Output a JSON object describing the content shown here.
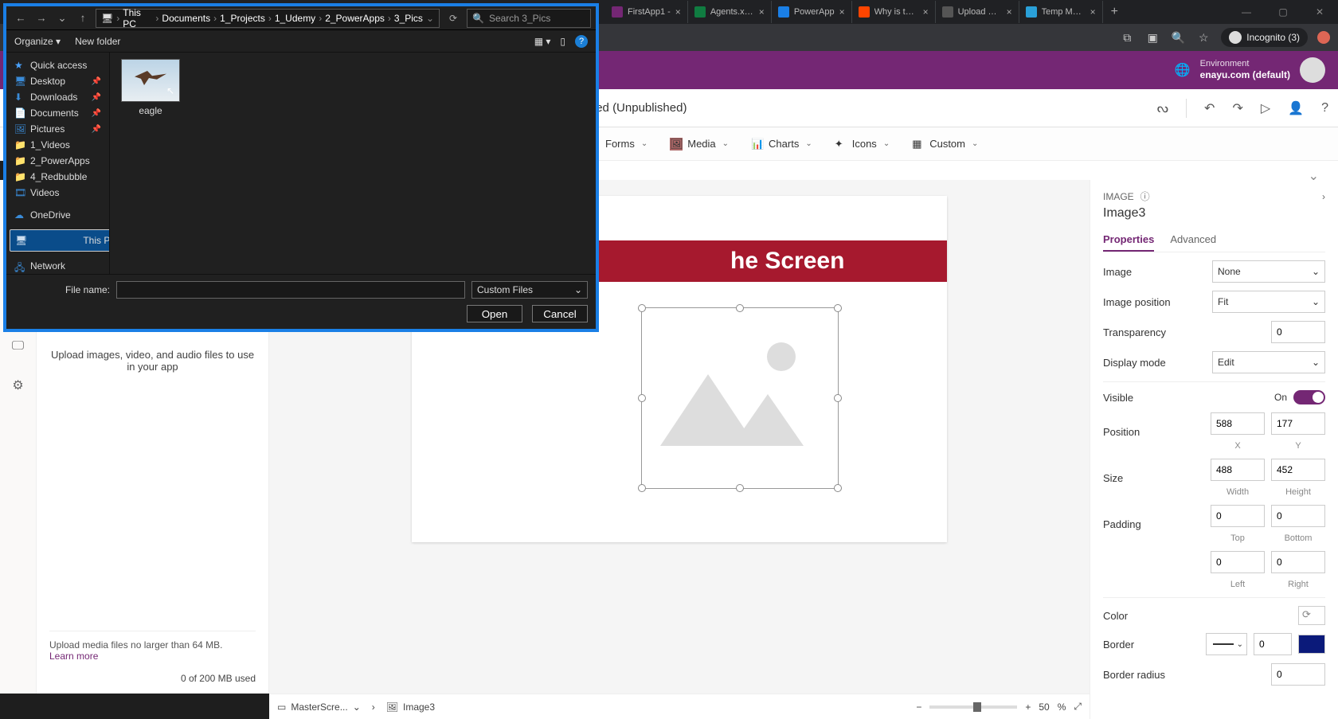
{
  "browser": {
    "tabs": [
      {
        "title": "FirstApp1 -",
        "fav": "#742774"
      },
      {
        "title": "Agents.xlsx",
        "fav": "#107c41"
      },
      {
        "title": "PowerApp",
        "fav": "#1a7fe6"
      },
      {
        "title": "Why is ther",
        "fav": "#ff4500"
      },
      {
        "title": "Upload File",
        "fav": "#444"
      },
      {
        "title": "Temp Mail -",
        "fav": "#2aa0d8"
      }
    ],
    "incognito": "Incognito (3)"
  },
  "env": {
    "label": "Environment",
    "name": "enayu.com (default)"
  },
  "app_title": "FirstCanvasApp - Saved (Unpublished)",
  "ribbon": {
    "forms": "Forms",
    "media": "Media",
    "charts": "Charts",
    "icons": "Icons",
    "custom": "Custom"
  },
  "media_pane": {
    "hint": "Upload images, video, and audio files to use in your app",
    "foot": "Upload media files no larger than 64 MB.",
    "learn": "Learn more",
    "usage": "0 of 200 MB used"
  },
  "canvas": {
    "banner": "he Screen"
  },
  "status": {
    "screen": "MasterScre...",
    "img": "Image3",
    "zoom": "50",
    "pct": "%"
  },
  "props": {
    "kind": "IMAGE",
    "name": "Image3",
    "tab_properties": "Properties",
    "tab_advanced": "Advanced",
    "image_lbl": "Image",
    "image_val": "None",
    "pos_lbl": "Image position",
    "pos_val": "Fit",
    "trans_lbl": "Transparency",
    "trans_val": "0",
    "disp_lbl": "Display mode",
    "disp_val": "Edit",
    "visible_lbl": "Visible",
    "visible_on": "On",
    "position_lbl": "Position",
    "x": "588",
    "y": "177",
    "xlab": "X",
    "ylab": "Y",
    "size_lbl": "Size",
    "w": "488",
    "h": "452",
    "wlab": "Width",
    "hlab": "Height",
    "pad_lbl": "Padding",
    "pt": "0",
    "pb": "0",
    "pl": "0",
    "pr": "0",
    "pt_lab": "Top",
    "pb_lab": "Bottom",
    "pl_lab": "Left",
    "pr_lab": "Right",
    "color_lbl": "Color",
    "border_lbl": "Border",
    "border_val": "0",
    "border_color": "#0b1a7a",
    "radius_lbl": "Border radius",
    "radius_val": "0"
  },
  "dialog": {
    "path": [
      "This PC",
      "Documents",
      "1_Projects",
      "1_Udemy",
      "2_PowerApps",
      "3_Pics"
    ],
    "search_placeholder": "Search 3_Pics",
    "organize": "Organize",
    "newfolder": "New folder",
    "tree": {
      "quick": "Quick access",
      "desktop": "Desktop",
      "downloads": "Downloads",
      "documents": "Documents",
      "pictures": "Pictures",
      "videos1": "1_Videos",
      "powerapps": "2_PowerApps",
      "redbubble": "4_Redbubble",
      "videos": "Videos",
      "onedrive": "OneDrive",
      "thispc": "This PC",
      "network": "Network"
    },
    "file": "eagle",
    "filename_label": "File name:",
    "filter": "Custom Files",
    "open": "Open",
    "cancel": "Cancel"
  }
}
